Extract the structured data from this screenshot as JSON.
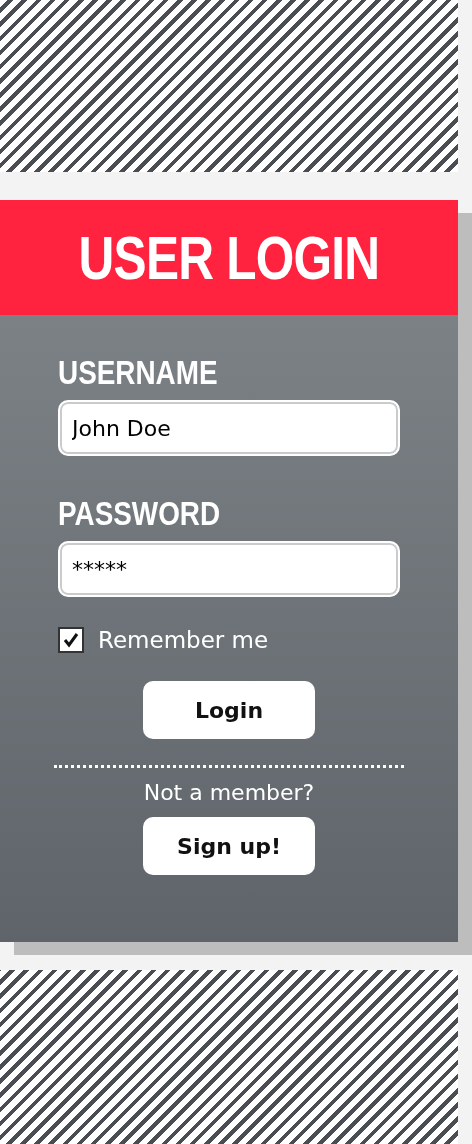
{
  "header": {
    "title": "USER LOGIN"
  },
  "fields": [
    {
      "label": "USERNAME",
      "value": "John Doe"
    },
    {
      "label": "PASSWORD",
      "value": "*****"
    }
  ],
  "remember": {
    "label": "Remember me",
    "checked": true
  },
  "login_button": "Login",
  "signup_prompt": "Not a member?",
  "signup_button": "Sign up!"
}
